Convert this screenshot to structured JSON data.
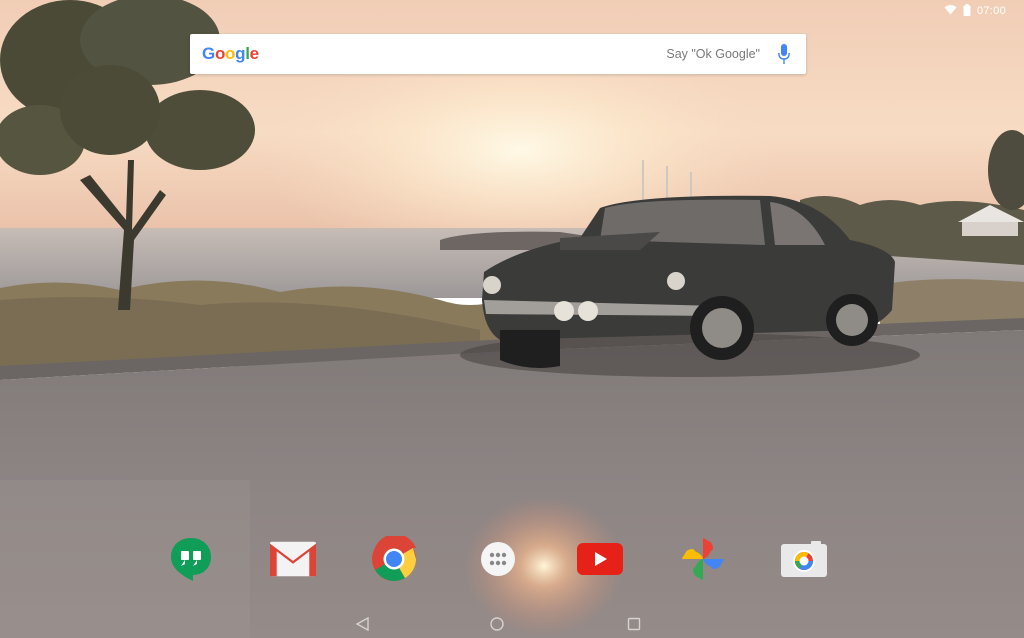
{
  "status_bar": {
    "time": "07:00",
    "icons": [
      "wifi-icon",
      "battery-icon"
    ]
  },
  "search": {
    "logo_text": [
      "G",
      "o",
      "o",
      "g",
      "l",
      "e"
    ],
    "logo_colors": [
      "#4285F4",
      "#EA4335",
      "#FBBC05",
      "#4285F4",
      "#34A853",
      "#EA4335"
    ],
    "hint": "Say \"Ok Google\"",
    "mic_icon": "mic-icon"
  },
  "dock": {
    "apps": [
      "hangouts-icon",
      "gmail-icon",
      "chrome-icon",
      "app-drawer-icon",
      "youtube-icon",
      "photos-icon",
      "camera-icon"
    ]
  },
  "nav_bar": {
    "buttons": [
      "back-icon",
      "home-icon",
      "recents-icon"
    ]
  },
  "colors": {
    "sky_top": "#f3d3bb",
    "sun": "#fff4d6",
    "sea": "#a9a7a8",
    "road": "#8c8684"
  }
}
